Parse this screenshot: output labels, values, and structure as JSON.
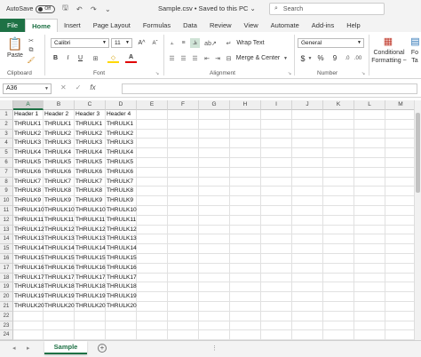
{
  "titlebar": {
    "autosave_label": "AutoSave",
    "autosave_state": "Off",
    "document_title": "Sample.csv • Saved to this PC ⌄",
    "search_placeholder": "Search"
  },
  "tabs": [
    "File",
    "Home",
    "Insert",
    "Page Layout",
    "Formulas",
    "Data",
    "Review",
    "View",
    "Automate",
    "Add-ins",
    "Help"
  ],
  "active_tab": "Home",
  "ribbon": {
    "clipboard": {
      "paste_label": "Paste",
      "group_label": "Clipboard"
    },
    "font": {
      "font_name": "Calibri",
      "font_size": "11",
      "bold": "B",
      "italic": "I",
      "underline": "U",
      "grow": "A^",
      "shrink": "Aˇ",
      "group_label": "Font"
    },
    "alignment": {
      "wrap_text": "Wrap Text",
      "merge_center": "Merge & Center",
      "group_label": "Alignment"
    },
    "number": {
      "format": "General",
      "currency": "$",
      "percent": "%",
      "comma": "9",
      "group_label": "Number"
    },
    "styles": {
      "conditional_formatting": "Conditional",
      "conditional_formatting_2": "Formatting ~",
      "format_as": "Fo",
      "format_as_2": "Ta"
    }
  },
  "formula_bar": {
    "name_box": "A36",
    "cancel": "✕",
    "enter": "✓",
    "fx": "fx",
    "value": ""
  },
  "grid": {
    "columns": [
      "A",
      "B",
      "C",
      "D",
      "E",
      "F",
      "G",
      "H",
      "I",
      "J",
      "K",
      "L",
      "M"
    ],
    "selected_column": "A",
    "row_numbers": [
      "1",
      "2",
      "3",
      "4",
      "5",
      "6",
      "7",
      "8",
      "9",
      "10",
      "11",
      "12",
      "13",
      "14",
      "15",
      "16",
      "17",
      "18",
      "19",
      "20",
      "21",
      "22",
      "23",
      "24"
    ],
    "rows": [
      [
        "Header 1",
        "Header 2",
        "Header 3",
        "Header 4"
      ],
      [
        "THRULK1",
        "THRULK1",
        "THRULK1",
        "THRULK1"
      ],
      [
        "THRULK2",
        "THRULK2",
        "THRULK2",
        "THRULK2"
      ],
      [
        "THRULK3",
        "THRULK3",
        "THRULK3",
        "THRULK3"
      ],
      [
        "THRULK4",
        "THRULK4",
        "THRULK4",
        "THRULK4"
      ],
      [
        "THRULK5",
        "THRULK5",
        "THRULK5",
        "THRULK5"
      ],
      [
        "THRULK6",
        "THRULK6",
        "THRULK6",
        "THRULK6"
      ],
      [
        "THRULK7",
        "THRULK7",
        "THRULK7",
        "THRULK7"
      ],
      [
        "THRULK8",
        "THRULK8",
        "THRULK8",
        "THRULK8"
      ],
      [
        "THRULK9",
        "THRULK9",
        "THRULK9",
        "THRULK9"
      ],
      [
        "THRULK10",
        "THRULK10",
        "THRULK10",
        "THRULK10"
      ],
      [
        "THRULK11",
        "THRULK11",
        "THRULK11",
        "THRULK11"
      ],
      [
        "THRULK12",
        "THRULK12",
        "THRULK12",
        "THRULK12"
      ],
      [
        "THRULK13",
        "THRULK13",
        "THRULK13",
        "THRULK13"
      ],
      [
        "THRULK14",
        "THRULK14",
        "THRULK14",
        "THRULK14"
      ],
      [
        "THRULK15",
        "THRULK15",
        "THRULK15",
        "THRULK15"
      ],
      [
        "THRULK16",
        "THRULK16",
        "THRULK16",
        "THRULK16"
      ],
      [
        "THRULK17",
        "THRULK17",
        "THRULK17",
        "THRULK17"
      ],
      [
        "THRULK18",
        "THRULK18",
        "THRULK18",
        "THRULK18"
      ],
      [
        "THRULK19",
        "THRULK19",
        "THRULK19",
        "THRULK19"
      ],
      [
        "THRULK20",
        "THRULK20",
        "THRULK20",
        "THRULK20"
      ],
      [
        "",
        "",
        "",
        ""
      ],
      [
        "",
        "",
        "",
        ""
      ],
      [
        "",
        "",
        "",
        ""
      ]
    ]
  },
  "sheets": {
    "active": "Sample",
    "add_label": "+",
    "nav_prev": "◂",
    "nav_next": "▸",
    "more": "⋮"
  },
  "colors": {
    "accent": "#1e7145",
    "ribbon_bg": "#f3f3f3"
  }
}
